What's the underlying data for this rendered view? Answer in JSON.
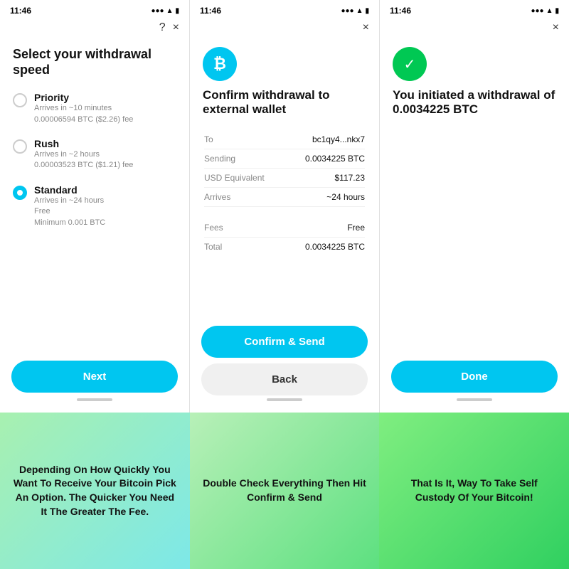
{
  "screens": [
    {
      "id": "screen1",
      "statusTime": "11:46",
      "title": "Select your withdrawal speed",
      "headerIcons": [
        "?",
        "×"
      ],
      "options": [
        {
          "id": "priority",
          "name": "Priority",
          "detail1": "Arrives in ~10 minutes",
          "detail2": "0.00006594 BTC ($2.26) fee",
          "selected": false
        },
        {
          "id": "rush",
          "name": "Rush",
          "detail1": "Arrives in ~2 hours",
          "detail2": "0.00003523 BTC ($1.21) fee",
          "selected": false
        },
        {
          "id": "standard",
          "name": "Standard",
          "detail1": "Arrives in ~24 hours",
          "detail2": "Free",
          "detail3": "Minimum 0.001 BTC",
          "selected": true
        }
      ],
      "buttonLabel": "Next"
    },
    {
      "id": "screen2",
      "statusTime": "11:46",
      "headerIcons": [
        "×"
      ],
      "iconLetter": "₿",
      "title": "Confirm withdrawal to external wallet",
      "details": [
        {
          "label": "To",
          "value": "bc1qy4...nkx7"
        },
        {
          "label": "Sending",
          "value": "0.0034225 BTC"
        },
        {
          "label": "USD Equivalent",
          "value": "$117.23"
        },
        {
          "label": "Arrives",
          "value": "~24 hours"
        }
      ],
      "details2": [
        {
          "label": "Fees",
          "value": "Free"
        },
        {
          "label": "Total",
          "value": "0.0034225 BTC"
        }
      ],
      "primaryButton": "Confirm & Send",
      "secondaryButton": "Back"
    },
    {
      "id": "screen3",
      "statusTime": "11:46",
      "headerIcons": [
        "×"
      ],
      "iconType": "check",
      "title": "You initiated a withdrawal of 0.0034225 BTC",
      "buttonLabel": "Done"
    }
  ],
  "captions": [
    {
      "text": "Depending On How Quickly You Want To Receive Your Bitcoin Pick An Option. The Quicker You Need It The Greater The Fee."
    },
    {
      "text": "Double Check Everything Then Hit Confirm & Send"
    },
    {
      "text": "That Is It, Way To Take Self Custody Of Your Bitcoin!"
    }
  ]
}
